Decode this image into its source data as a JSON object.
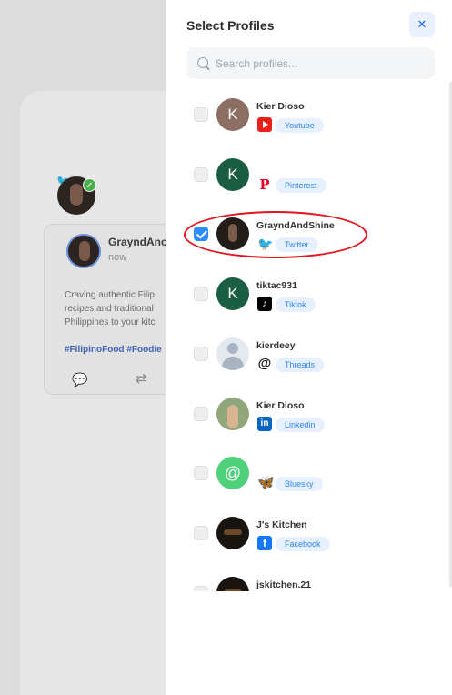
{
  "background": {
    "post": {
      "author": "GrayndAnc",
      "time": "now",
      "body_lines": [
        "Craving authentic Filip",
        "recipes and traditional",
        "Philippines to your kitc"
      ],
      "tags": "#FilipinoFood #Foodie"
    }
  },
  "drawer": {
    "title": "Select Profiles",
    "close_label": "✕",
    "search_placeholder": "Search profiles..."
  },
  "profiles": [
    {
      "name": "Kier Dioso",
      "platform": "Youtube",
      "avatar_letter": "K",
      "checked": false,
      "icon": "youtube-icon"
    },
    {
      "name": "",
      "platform": "Pinterest",
      "avatar_letter": "K",
      "checked": false,
      "icon": "pinterest-icon"
    },
    {
      "name": "GrayndAndShine",
      "platform": "Twitter",
      "avatar_letter": "",
      "checked": true,
      "icon": "twitter-icon"
    },
    {
      "name": "tiktac931",
      "platform": "Tiktok",
      "avatar_letter": "K",
      "checked": false,
      "icon": "tiktok-icon"
    },
    {
      "name": "kierdeey",
      "platform": "Threads",
      "avatar_letter": "",
      "checked": false,
      "icon": "threads-icon"
    },
    {
      "name": "Kier Dioso",
      "platform": "Linkedin",
      "avatar_letter": "",
      "checked": false,
      "icon": "linkedin-icon"
    },
    {
      "name": "",
      "platform": "Bluesky",
      "avatar_letter": "@",
      "checked": false,
      "icon": "bluesky-icon"
    },
    {
      "name": "J's Kitchen",
      "platform": "Facebook",
      "avatar_letter": "",
      "checked": false,
      "icon": "facebook-icon"
    },
    {
      "name": "jskitchen.21",
      "platform": "",
      "avatar_letter": "",
      "checked": false,
      "icon": ""
    }
  ],
  "icons": {
    "pinterest": "P",
    "twitter": "🐦",
    "tiktok": "♪",
    "threads": "@",
    "linkedin": "in",
    "bluesky": "🦋",
    "facebook": "f",
    "check": "✓",
    "comment": "💬",
    "retweet": "⇄",
    "tw_small": "🐦"
  },
  "colors": {
    "accent": "#2d8cff",
    "highlight": "#e3141b"
  }
}
